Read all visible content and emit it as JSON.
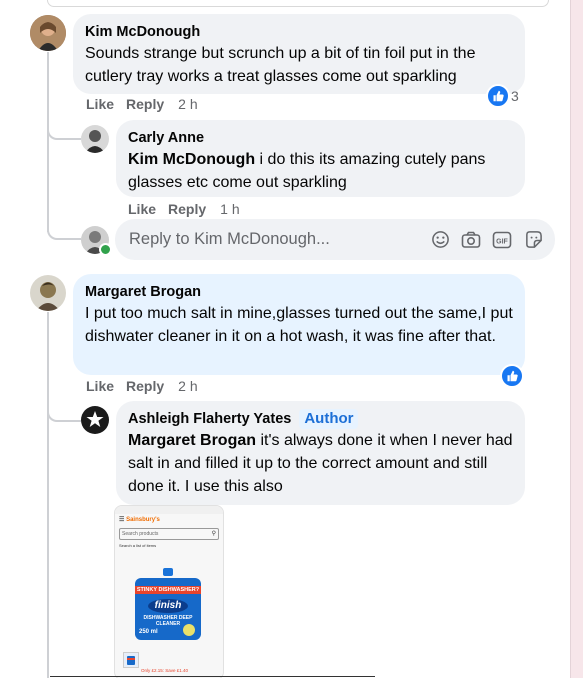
{
  "comments": [
    {
      "author": "Kim McDonough",
      "text": "Sounds strange but scrunch up a bit of tin foil put in the cutlery tray works a treat glasses come out sparkling",
      "actions": {
        "like": "Like",
        "reply": "Reply",
        "time": "2 h"
      },
      "reactions": "3",
      "replies": [
        {
          "author": "Carly Anne",
          "mention": "Kim McDonough",
          "text": " i do this its amazing cutely pans glasses etc come out sparkling",
          "actions": {
            "like": "Like",
            "reply": "Reply",
            "time": "1 h"
          }
        }
      ],
      "reply_placeholder": "Reply to Kim McDonough..."
    },
    {
      "author": "Margaret Brogan",
      "text": "I put too much salt in mine,glasses turned out the same,I put dishwater cleaner in it on a hot wash, it was fine after that.",
      "actions": {
        "like": "Like",
        "reply": "Reply",
        "time": "2 h"
      },
      "replies": [
        {
          "author": "Ashleigh Flaherty Yates",
          "badge": "Author",
          "mention": "Margaret Brogan",
          "text": " it's always done it when I never had salt in and filled it up to the correct amount and still done it. I use this also",
          "attachment": {
            "site": "Sainsbury's",
            "search_placeholder": "Search products",
            "results": "Search a list of items",
            "product_banner": "STINKY DISHWASHER?",
            "brand": "finish",
            "product": "DISHWASHER DEEP CLEANER",
            "volume": "250 ml",
            "promo": "Only £2.15: Save £1.40"
          }
        }
      ]
    }
  ],
  "colors": {
    "accent": "#1877f2",
    "bubble": "#f0f2f5",
    "highlight": "#e7f3ff"
  }
}
